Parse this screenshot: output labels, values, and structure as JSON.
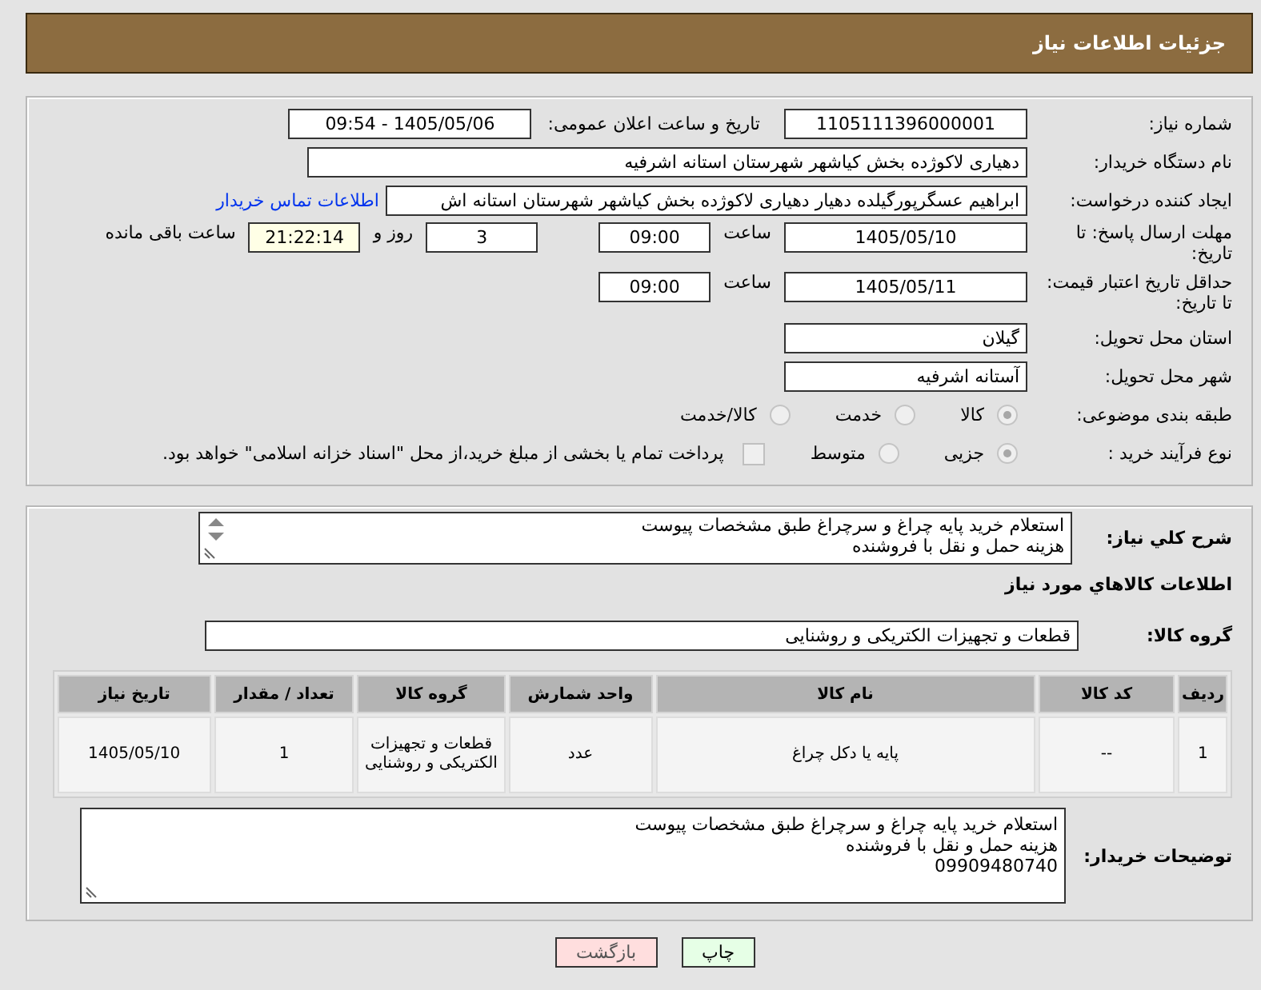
{
  "header": {
    "title": "جزئیات اطلاعات نیاز"
  },
  "need_number": {
    "label": "شماره نیاز:",
    "value": "1105111396000001"
  },
  "announce": {
    "label": "تاریخ و ساعت اعلان عمومی:",
    "value": "1405/05/06 - 09:54"
  },
  "buyer_org": {
    "label": "نام دستگاه خریدار:",
    "value": "دهیاری لاکوژده بخش کیاشهر شهرستان استانه اشرفیه"
  },
  "requester": {
    "label": "ایجاد کننده درخواست:",
    "value": "ابراهیم عسگرپورگیلده دهیار دهیاری لاکوژده بخش کیاشهر شهرستان استانه اش",
    "link": "اطلاعات تماس خریدار"
  },
  "deadline": {
    "label": "مهلت ارسال پاسخ: تا تاریخ:",
    "date": "1405/05/10",
    "time_label": "ساعت",
    "time": "09:00",
    "days": "3",
    "days_label": "روز و",
    "remaining": "21:22:14",
    "remaining_label": "ساعت باقی مانده"
  },
  "validity": {
    "label": "حداقل تاریخ اعتبار قیمت: تا تاریخ:",
    "date": "1405/05/11",
    "time_label": "ساعت",
    "time": "09:00"
  },
  "province": {
    "label": "استان محل تحویل:",
    "value": "گیلان"
  },
  "city": {
    "label": "شهر محل تحویل:",
    "value": "آستانه اشرفیه"
  },
  "category": {
    "label": "طبقه بندی موضوعی:",
    "options": [
      {
        "label": "کالا",
        "selected": true
      },
      {
        "label": "خدمت",
        "selected": false
      },
      {
        "label": "کالا/خدمت",
        "selected": false
      }
    ]
  },
  "purchase_type": {
    "label": "نوع فرآیند خرید :",
    "options": [
      {
        "label": "جزیی",
        "selected": true
      },
      {
        "label": "متوسط",
        "selected": false
      }
    ],
    "payment": {
      "label": "پرداخت تمام یا بخشی از مبلغ خرید،از محل \"اسناد خزانه اسلامی\" خواهد بود.",
      "checked": false
    }
  },
  "description": {
    "label": "شرح کلي نیاز:",
    "text": "استعلام خرید پایه چراغ و سرچراغ طبق مشخصات پیوست\nهزینه حمل و نقل با فروشنده"
  },
  "goods_title": "اطلاعات کالاهاي مورد نیاز",
  "goods_group": {
    "label": "گروه کالا:",
    "value": "قطعات و تجهیزات الکتریکی و روشنایی"
  },
  "table": {
    "columns": [
      "ردیف",
      "کد کالا",
      "نام کالا",
      "واحد شمارش",
      "گروه کالا",
      "تعداد / مقدار",
      "تاریخ نیاز"
    ],
    "rows": [
      [
        "1",
        "--",
        "پایه یا دکل چراغ",
        "عدد",
        "قطعات و تجهیزات الکتریکی و روشنایی",
        "1",
        "1405/05/10"
      ]
    ]
  },
  "buyer_notes": {
    "label": "توضیحات خریدار:",
    "text": "استعلام خرید پایه چراغ و سرچراغ طبق مشخصات پیوست\nهزینه حمل و نقل با فروشنده\n09909480740"
  },
  "buttons": [
    {
      "label": "چاپ",
      "kind": "print"
    },
    {
      "label": "بازگشت",
      "kind": "back"
    }
  ]
}
